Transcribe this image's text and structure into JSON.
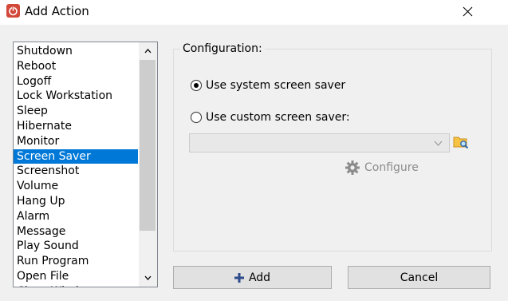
{
  "window": {
    "title": "Add Action",
    "app_icon": "power-icon",
    "close_icon": "close-icon"
  },
  "action_list": {
    "items": [
      {
        "label": "Shutdown"
      },
      {
        "label": "Reboot"
      },
      {
        "label": "Logoff"
      },
      {
        "label": "Lock Workstation"
      },
      {
        "label": "Sleep"
      },
      {
        "label": "Hibernate"
      },
      {
        "label": "Monitor"
      },
      {
        "label": "Screen Saver",
        "selected": true
      },
      {
        "label": "Screenshot"
      },
      {
        "label": "Volume"
      },
      {
        "label": "Hang Up"
      },
      {
        "label": "Alarm"
      },
      {
        "label": "Message"
      },
      {
        "label": "Play Sound"
      },
      {
        "label": "Run Program"
      },
      {
        "label": "Open File"
      },
      {
        "label": "Close Window"
      }
    ],
    "selected_color": "#0078d7"
  },
  "configuration": {
    "label": "Configuration:",
    "system_saver_label": "Use system screen saver",
    "custom_saver_label": "Use custom screen saver:",
    "system_selected": true,
    "custom_path_value": "",
    "configure_label": "Configure"
  },
  "buttons": {
    "add_label": "Add",
    "cancel_label": "Cancel"
  }
}
